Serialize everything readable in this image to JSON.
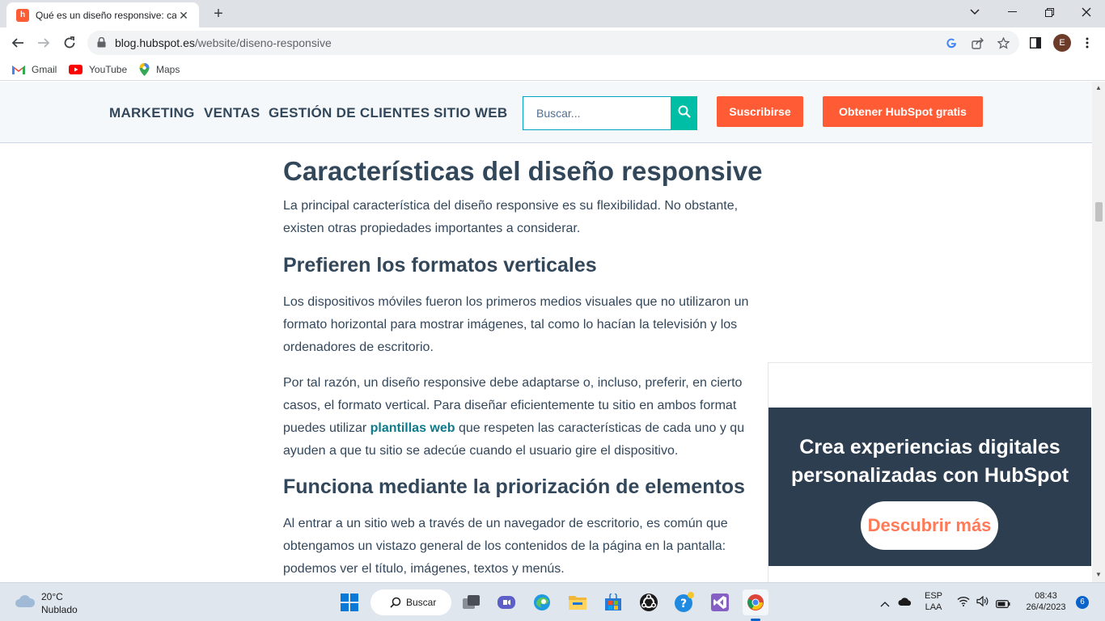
{
  "browser": {
    "tab_title": "Qué es un diseño responsive: car",
    "url_host": "blog.hubspot.es",
    "url_path": "/website/diseno-responsive",
    "avatar_letter": "E",
    "bookmarks": [
      {
        "label": "Gmail",
        "icon": "gmail-icon"
      },
      {
        "label": "YouTube",
        "icon": "youtube-icon"
      },
      {
        "label": "Maps",
        "icon": "maps-icon"
      }
    ]
  },
  "site_nav": {
    "links": [
      "MARKETING",
      "VENTAS",
      "GESTIÓN DE CLIENTES",
      "SITIO WEB"
    ],
    "search_placeholder": "Buscar...",
    "subscribe_label": "Suscribirse",
    "get_hubspot_label": "Obtener HubSpot gratis"
  },
  "article": {
    "h2": "Características del diseño responsive",
    "p1": [
      "La principal característica del diseño responsive es su flexibilidad. No obstante,",
      "existen otras propiedades importantes a considerar."
    ],
    "h3a": "Prefieren los formatos verticales",
    "p2": [
      "Los dispositivos móviles fueron los primeros medios visuales que no utilizaron un",
      "formato horizontal para mostrar imágenes, tal como lo hacían la televisión y los",
      "ordenadores de escritorio."
    ],
    "p3_line1": "Por tal razón, un diseño responsive debe adaptarse o, incluso, preferir, en cierto",
    "p3_line2": "casos, el formato vertical. Para diseñar eficientemente tu sitio en ambos format",
    "p3_line3_before": "puedes utilizar ",
    "p3_link": "plantillas web",
    "p3_line3_after": " que respeten las características de cada uno y qu",
    "p3_line4": "ayuden a que tu sitio se adecúe cuando el usuario gire el dispositivo.",
    "h3b": "Funciona mediante la priorización de elementos",
    "p4": [
      "Al entrar a un sitio web a través de un navegador de escritorio, es común que",
      "obtengamos un vistazo general de los contenidos de la página en la pantalla:",
      "podemos ver el título, imágenes, textos y menús."
    ]
  },
  "cta": {
    "title_line1": "Crea experiencias digitales",
    "title_line2": "personalizadas con HubSpot",
    "button_label": "Descubrir más"
  },
  "taskbar": {
    "temperature": "20°C",
    "weather": "Nublado",
    "search_label": "Buscar",
    "lang_line1": "ESP",
    "lang_line2": "LAA",
    "time": "08:43",
    "date": "26/4/2023",
    "notification_count": "6"
  },
  "colors": {
    "accent_orange": "#ff5c35",
    "teal": "#00bda5",
    "heading": "#33475b",
    "cta_bg": "#2d3e50"
  }
}
